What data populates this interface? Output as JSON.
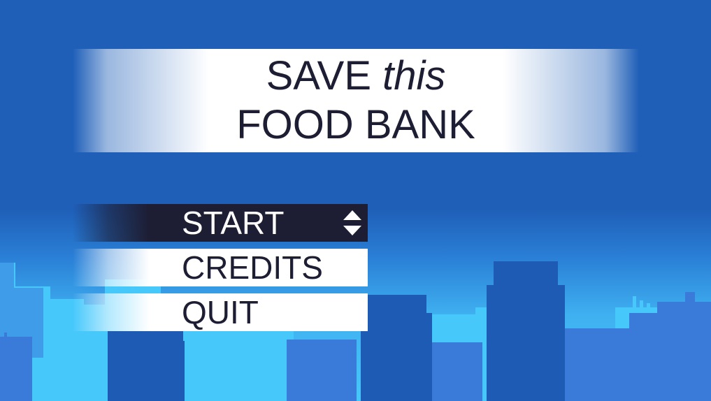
{
  "title": {
    "line1_main": "SAVE",
    "line1_emphasis": "this",
    "line2": "FOOD BANK"
  },
  "menu": {
    "items": [
      {
        "label": "START",
        "selected": true
      },
      {
        "label": "CREDITS",
        "selected": false
      },
      {
        "label": "QUIT",
        "selected": false
      }
    ],
    "selector_icon": "up-down-arrows-icon"
  },
  "colors": {
    "sky": "#1f5fb8",
    "skyline_light": "#46c8fb",
    "building_dark": "#1e5bb5",
    "building_mid": "#3a7ad8",
    "menu_selected_bg": "#1d1d33",
    "menu_bg": "#ffffff",
    "text_dark": "#1d1d33",
    "text_light": "#ffffff"
  }
}
